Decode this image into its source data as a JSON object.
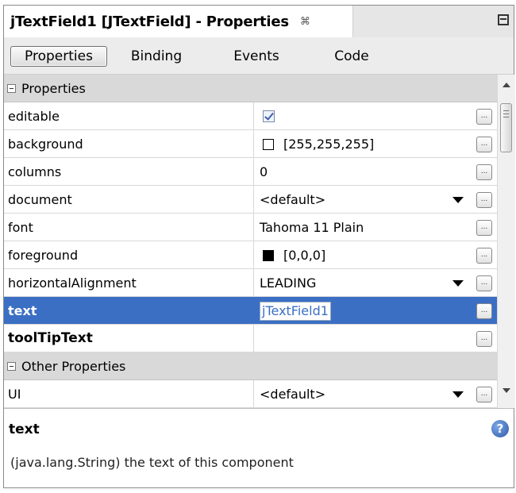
{
  "window": {
    "title": "jTextField1 [JTextField] - Properties",
    "close_glyph": "⌘"
  },
  "tabs": [
    {
      "label": "Properties",
      "active": true
    },
    {
      "label": "Binding",
      "active": false
    },
    {
      "label": "Events",
      "active": false
    },
    {
      "label": "Code",
      "active": false
    }
  ],
  "sections": {
    "properties": "Properties",
    "other": "Other Properties"
  },
  "rows": {
    "editable": {
      "name": "editable",
      "checked": true
    },
    "background": {
      "name": "background",
      "value": "[255,255,255]",
      "color": "#ffffff"
    },
    "columns": {
      "name": "columns",
      "value": "0"
    },
    "document": {
      "name": "document",
      "value": "<default>"
    },
    "font": {
      "name": "font",
      "value": "Tahoma 11 Plain"
    },
    "foreground": {
      "name": "foreground",
      "value": "[0,0,0]",
      "color": "#000000"
    },
    "horizontalAlignment": {
      "name": "horizontalAlignment",
      "value": "LEADING"
    },
    "text": {
      "name": "text",
      "value": "jTextField1"
    },
    "toolTipText": {
      "name": "toolTipText",
      "value": ""
    },
    "ui": {
      "name": "UI",
      "value": "<default>"
    }
  },
  "ellipsis_label": "...",
  "description": {
    "title": "text",
    "text": "(java.lang.String) the text of this component",
    "help_glyph": "?"
  },
  "colors": {
    "selection": "#3b6fc4",
    "section_bg": "#d9d9d9"
  }
}
